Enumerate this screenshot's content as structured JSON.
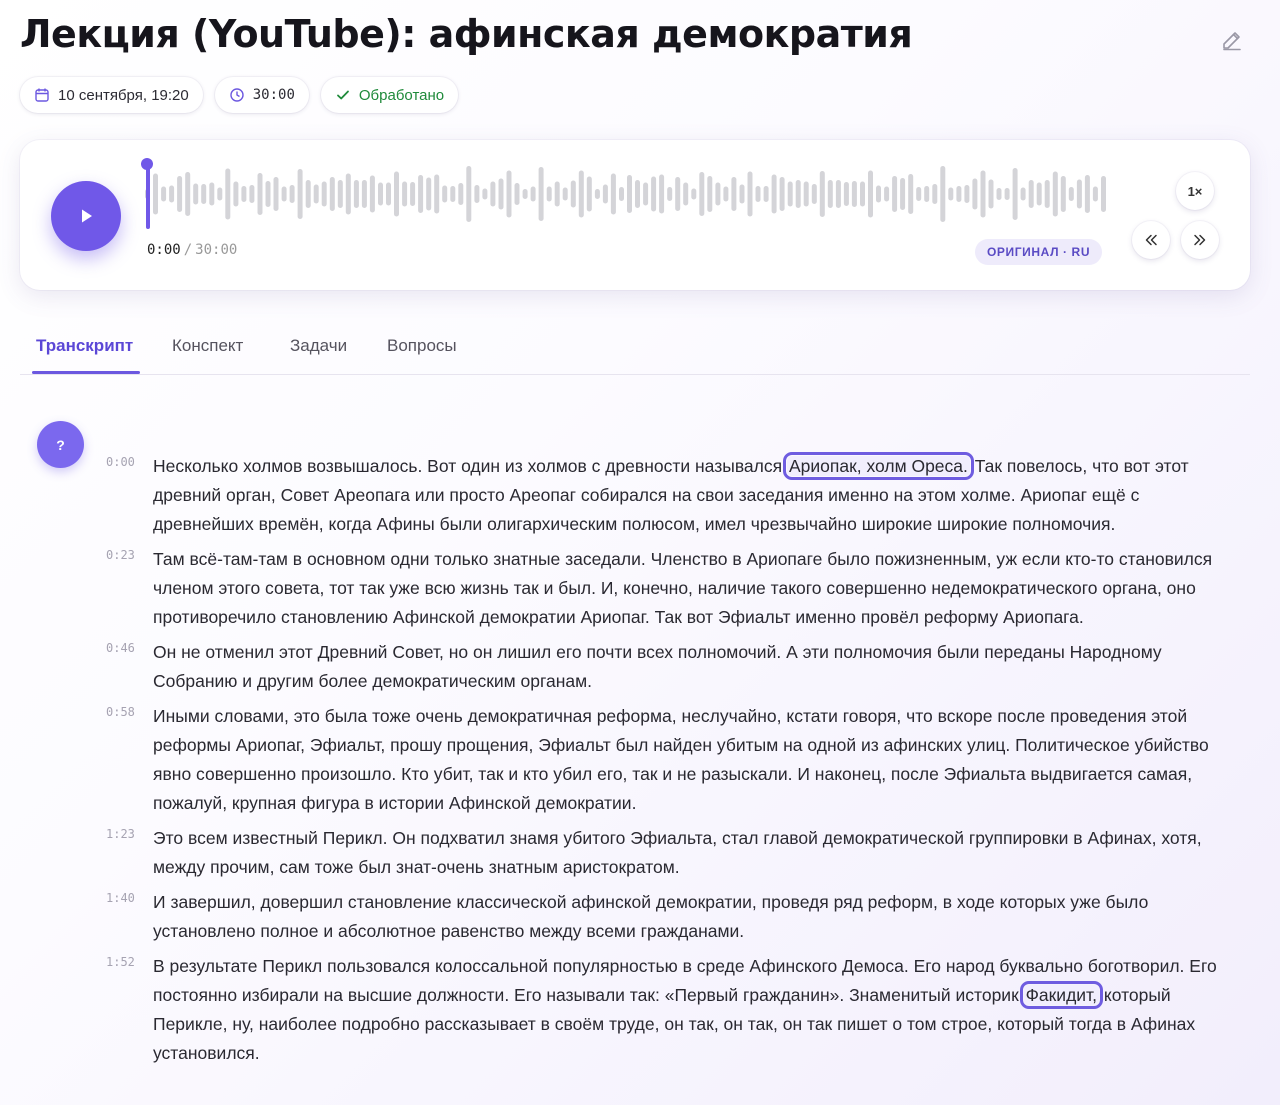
{
  "header": {
    "title": "Лекция (YouTube): афинская демократия",
    "date_label": "10 сентября, 19:20",
    "duration_label": "30:00",
    "status_label": "Обработано"
  },
  "player": {
    "current_time": "0:00",
    "separator": "/",
    "total_time": "30:00",
    "language_badge": "ОРИГИНАЛ · RU",
    "speed_label": "1×",
    "progress": 0
  },
  "tabs": [
    {
      "label": "Транскрипт",
      "active": true
    },
    {
      "label": "Конспект",
      "active": false
    },
    {
      "label": "Задачи",
      "active": false
    },
    {
      "label": "Вопросы",
      "active": false
    }
  ],
  "help_label": "?",
  "transcript": [
    {
      "time": "0:00",
      "text_before": "Несколько холмов возвышалось. Вот один из холмов с древности назывался ",
      "highlight": "Ариопак, холм Ореса.",
      "text_after": " Так повелось, что вот этот древний орган, Совет Ареопага или просто Ареопаг собирался на свои заседания именно на этом холме. Ариопаг ещё с древнейших времён, когда Афины были олигархическим полюсом, имел чрезвычайно широкие широкие полномочия."
    },
    {
      "time": "0:23",
      "text_before": "Там всё-там-там в основном одни только знатные заседали. Членство в Ариопаге было пожизненным, уж если кто-то становился членом этого совета, тот так уже всю жизнь так и был. И, конечно, наличие такого совершенно недемократического органа, оно противоречило становлению Афинской демократии Ариопаг. Так вот Эфиальт именно провёл реформу Ариопага.",
      "highlight": "",
      "text_after": ""
    },
    {
      "time": "0:46",
      "text_before": "Он не отменил этот Древний Совет, но он лишил его почти всех полномочий. А эти полномочия были переданы Народному Собранию и другим более демократическим органам.",
      "highlight": "",
      "text_after": ""
    },
    {
      "time": "0:58",
      "text_before": "Иными словами, это была тоже очень демократичная реформа, неслучайно, кстати говоря, что вскоре после проведения этой реформы Ариопаг, Эфиальт, прошу прощения, Эфиальт был найден убитым на одной из афинских улиц. Политическое убийство явно совершенно произошло. Кто убит, так и кто убил его, так и не разыскали. И наконец, после Эфиальта выдвигается самая, пожалуй, крупная фигура в истории Афинской демократии.",
      "highlight": "",
      "text_after": ""
    },
    {
      "time": "1:23",
      "text_before": "Это всем известный Перикл. Он подхватил знамя убитого Эфиальта, стал главой демократической группировки в Афинах, хотя, между прочим, сам тоже был знат-очень знатным аристократом.",
      "highlight": "",
      "text_after": ""
    },
    {
      "time": "1:40",
      "text_before": "И завершил, довершил становление классической афинской демократии, проведя ряд реформ, в ходе которых уже было установлено полное и абсолютное равенство между всеми гражданами.",
      "highlight": "",
      "text_after": ""
    },
    {
      "time": "1:52",
      "text_before": "В результате Перикл пользовался колоссальной популярностью в среде Афинского Демоса. Его народ буквально боготворил. Его постоянно избирали на высшие должности. Его называли так: «Первый гражданин». Знаменитый историк ",
      "highlight": "Факидит,",
      "text_after": " который Перикле, ну, наиболее подробно рассказывает в своём труде, он так, он так, он так пишет о том строе, который тогда в Афинах установился."
    }
  ],
  "colors": {
    "accent": "#7058e8",
    "status_green": "#1f8a3a",
    "waveform_bar": "#d4d4d8"
  },
  "icons": {
    "edit": "pencil-icon",
    "date": "calendar-icon",
    "duration": "clock-icon",
    "status": "check-icon",
    "play": "play-icon",
    "rewind": "chevrons-left-icon",
    "forward": "chevrons-right-icon"
  }
}
